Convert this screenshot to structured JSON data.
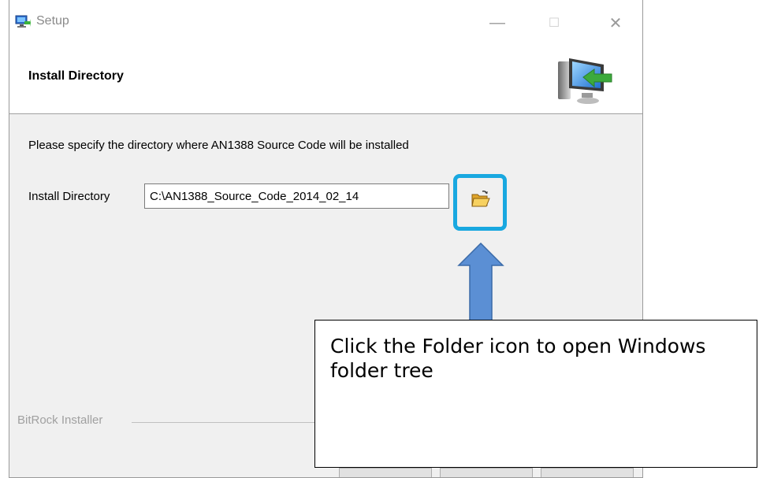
{
  "window": {
    "title": "Setup",
    "controls": {
      "minimize": "—",
      "maximize": "☐",
      "close": "✕"
    }
  },
  "header": {
    "title": "Install Directory",
    "icon": "computer-install-arrow-icon"
  },
  "body": {
    "instruction": "Please specify the directory where AN1388 Source Code will be installed",
    "directory_label": "Install Directory",
    "directory_value": "C:\\AN1388_Source_Code_2014_02_14",
    "browse_icon": "folder-open-icon"
  },
  "footer": {
    "brand": "BitRock Installer"
  },
  "annotation": {
    "callout_text": "Click the Folder icon to open Windows folder tree",
    "highlight_color": "#19a8e0",
    "arrow_color": "#5b8fd4"
  }
}
